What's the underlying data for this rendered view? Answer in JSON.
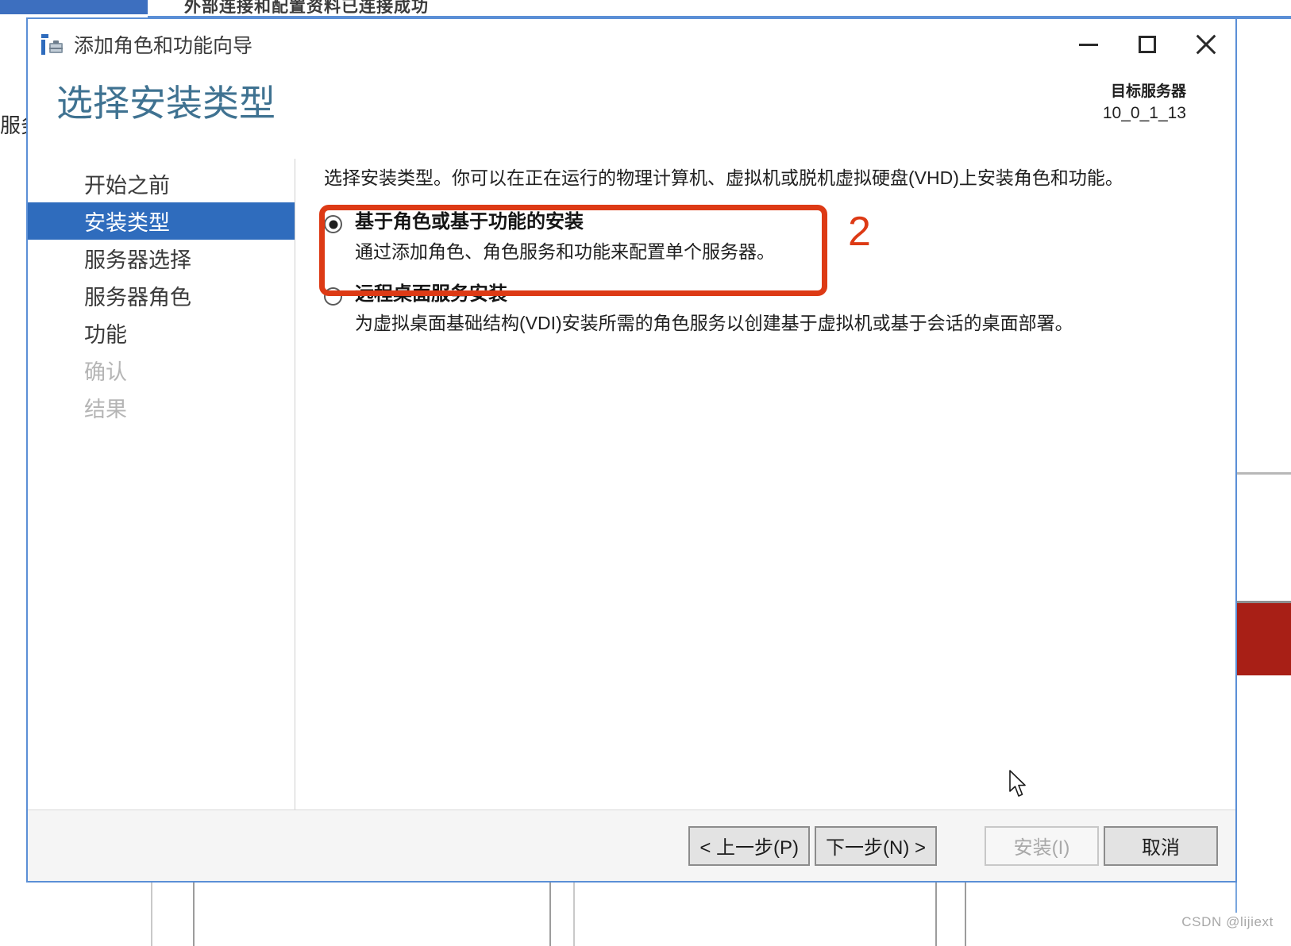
{
  "background": {
    "top_cut_text": "外部连接和配置资料已连接成功",
    "left_label": "服务",
    "watermark": "CSDN @lijiext"
  },
  "window": {
    "title": "添加角色和功能向导",
    "icon": "server-wizard-icon",
    "controls": {
      "minimize": "minimize-icon",
      "maximize": "maximize-icon",
      "close": "close-icon"
    }
  },
  "header": {
    "page_title": "选择安装类型",
    "target_server_label": "目标服务器",
    "target_server_value": "10_0_1_13"
  },
  "nav": {
    "items": [
      {
        "label": "开始之前",
        "state": "normal"
      },
      {
        "label": "安装类型",
        "state": "selected"
      },
      {
        "label": "服务器选择",
        "state": "normal"
      },
      {
        "label": "服务器角色",
        "state": "normal"
      },
      {
        "label": "功能",
        "state": "normal"
      },
      {
        "label": "确认",
        "state": "disabled"
      },
      {
        "label": "结果",
        "state": "disabled"
      }
    ]
  },
  "content": {
    "description": "选择安装类型。你可以在正在运行的物理计算机、虚拟机或脱机虚拟硬盘(VHD)上安装角色和功能。",
    "options": [
      {
        "title": "基于角色或基于功能的安装",
        "desc": "通过添加角色、角色服务和功能来配置单个服务器。",
        "checked": true
      },
      {
        "title": "远程桌面服务安装",
        "desc": "为虚拟桌面基础结构(VDI)安装所需的角色服务以创建基于虚拟机或基于会话的桌面部署。",
        "checked": false
      }
    ]
  },
  "footer": {
    "previous": "< 上一步(P)",
    "next": "下一步(N) >",
    "install": "安装(I)",
    "cancel": "取消"
  },
  "annotation": {
    "number": "2",
    "color": "#dd3a15"
  },
  "colors": {
    "accent_blue": "#2f6cbd",
    "title_blue": "#3f7291",
    "window_border": "#5b8fd6",
    "annotation_red": "#dd3a15",
    "bg_red_block": "#a81f16"
  }
}
